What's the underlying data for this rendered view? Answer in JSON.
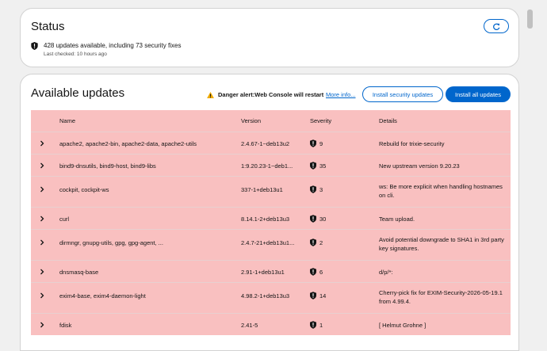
{
  "status": {
    "title": "Status",
    "summary": "428 updates available, including 73 security fixes",
    "last_checked": "Last checked: 10 hours ago"
  },
  "updates": {
    "title": "Available updates",
    "alert_text": "Danger alert:Web Console will restart",
    "more_info": "More info...",
    "install_security": "Install security updates",
    "install_all": "Install all updates",
    "columns": {
      "name": "Name",
      "version": "Version",
      "severity": "Severity",
      "details": "Details"
    },
    "rows": [
      {
        "name": "apache2, apache2-bin, apache2-data, apache2-utils",
        "version": "2.4.67-1~deb13u2",
        "severity": "9",
        "details": "Rebuild for trixie-security"
      },
      {
        "name": "bind9-dnsutils, bind9-host, bind9-libs",
        "version": "1:9.20.23-1~deb1...",
        "severity": "35",
        "details": "New upstream version 9.20.23"
      },
      {
        "name": "cockpit, cockpit-ws",
        "version": "337-1+deb13u1",
        "severity": "3",
        "details": "ws: Be more explicit when handling hostnames on cli."
      },
      {
        "name": "curl",
        "version": "8.14.1-2+deb13u3",
        "severity": "30",
        "details": "Team upload."
      },
      {
        "name": "dirmngr, gnupg-utils, gpg, gpg-agent, ...",
        "version": "2.4.7-21+deb13u1...",
        "severity": "2",
        "details": "Avoid potential downgrade to SHA1 in 3rd party key signatures."
      },
      {
        "name": "dnsmasq-base",
        "version": "2.91-1+deb13u1",
        "severity": "6",
        "details": "d/p/*:"
      },
      {
        "name": "exim4-base, exim4-daemon-light",
        "version": "4.98.2-1+deb13u3",
        "severity": "14",
        "details": "Cherry-pick fix for EXIM-Security-2026-05-19.1 from 4.99.4."
      },
      {
        "name": "fdisk",
        "version": "2.41-5",
        "severity": "1",
        "details": "[ Helmut Grohne ]"
      }
    ]
  },
  "colors": {
    "accent": "#0066cc",
    "danger_row": "#f9c0c0",
    "warning": "#f0ab00"
  }
}
